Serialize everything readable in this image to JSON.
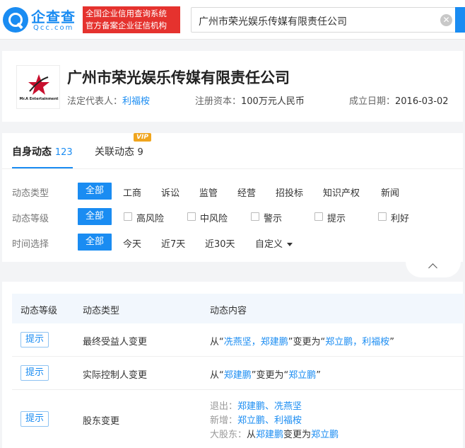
{
  "header": {
    "logo_cn": "企查查",
    "logo_en": "Qcc.com",
    "slogan_line1": "全国企业信用查询系统",
    "slogan_line2": "官方备案企业征信机构",
    "search_value": "广州市荣光娱乐传媒有限责任公司"
  },
  "company": {
    "logo_text": "Mr.A Entertainment",
    "name": "广州市荣光娱乐传媒有限责任公司",
    "legal_rep_label": "法定代表人：",
    "legal_rep": "利福桉",
    "capital_label": "注册资本：",
    "capital": "100万元人民币",
    "founded_label": "成立日期：",
    "founded": "2016-03-02"
  },
  "tabs": {
    "self_label": "自身动态",
    "self_count": "123",
    "related_label": "关联动态",
    "related_count": "9",
    "vip": "VIP"
  },
  "filters": {
    "type_label": "动态类型",
    "type_options": [
      "全部",
      "工商",
      "诉讼",
      "监管",
      "经营",
      "招投标",
      "知识产权",
      "新闻"
    ],
    "level_label": "动态等级",
    "level_all": "全部",
    "level_options": [
      "高风险",
      "中风险",
      "警示",
      "提示",
      "利好"
    ],
    "time_label": "时间选择",
    "time_options": [
      "全部",
      "今天",
      "近7天",
      "近30天",
      "自定义"
    ]
  },
  "table": {
    "headers": [
      "动态等级",
      "动态类型",
      "动态内容"
    ],
    "rows": [
      {
        "level": "提示",
        "type": "最终受益人变更",
        "c1": "从“",
        "c2": "冼燕坚，郑建鹏",
        "c3": "”变更为“",
        "c4": "郑立鹏，利福桉",
        "c5": "”"
      },
      {
        "level": "提示",
        "type": "实际控制人变更",
        "c1": "从“",
        "c2": "郑建鹏",
        "c3": "”变更为“",
        "c4": "郑立鹏",
        "c5": "”"
      },
      {
        "level": "提示",
        "type": "股东变更",
        "exit_label": "退出：",
        "exit_value": "郑建鹏、冼燕坚",
        "add_label": "新增：",
        "add_value": "郑立鹏、利福桉",
        "major_label": "大股东：",
        "major_from_prefix": "从",
        "major_from": "郑建鹏",
        "major_mid": "变更为",
        "major_to": "郑立鹏"
      }
    ]
  }
}
